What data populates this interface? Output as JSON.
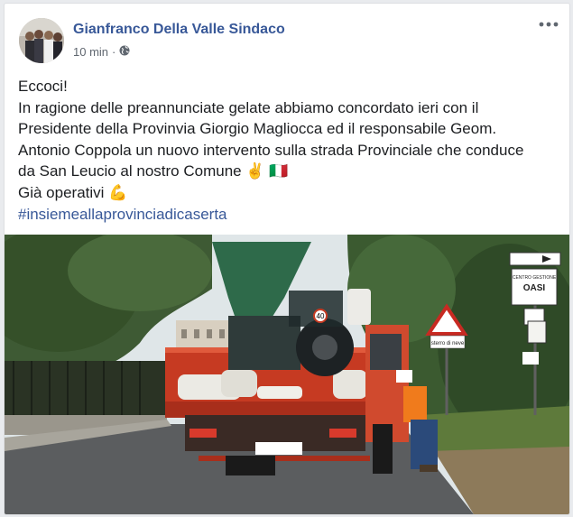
{
  "post": {
    "author": "Gianfranco Della Valle Sindaco",
    "timestamp": "10 min",
    "separator": "·",
    "audience_icon": "globe-icon",
    "more_icon": "more-options-icon",
    "lines": [
      "Eccoci!",
      "In ragione delle preannunciate gelate abbiamo concordato ieri con il",
      "Presidente della Provinvia Giorgio Magliocca ed il responsabile Geom.",
      "Antonio Coppola un nuovo intervento sulla strada Provinciale che conduce",
      "da San Leucio al nostro Comune ✌️ 🇮🇹",
      "Già operativi 💪"
    ],
    "hashtag": "#insiemeallaprovinciadicaserta"
  },
  "photo": {
    "speed_plate": "40",
    "sign_top": "OASI",
    "sign_small": "CENTRO GESTIONE",
    "sign_triangle": "sterro di neve"
  },
  "colors": {
    "link": "#385898",
    "text": "#1c1e21",
    "meta": "#606770",
    "truck_red": "#c63a22",
    "truck_body": "#d0452c"
  }
}
